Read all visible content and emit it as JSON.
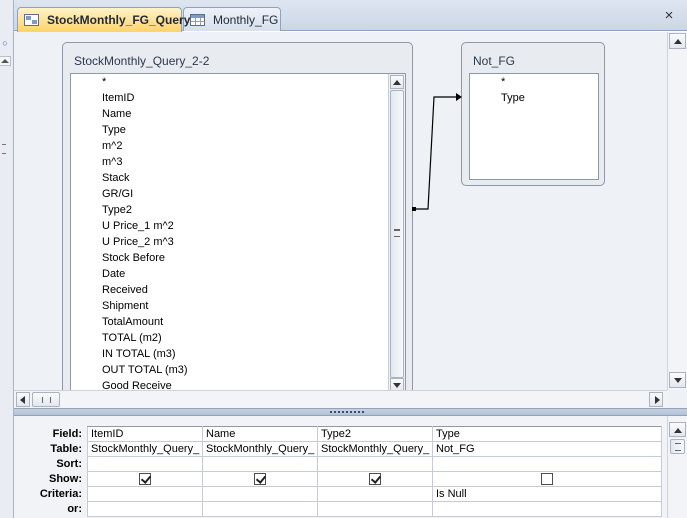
{
  "tabs": [
    {
      "label": "StockMonthly_FG_Query",
      "icon": "query-icon",
      "active": true
    },
    {
      "label": "Monthly_FG",
      "icon": "table-icon",
      "active": false
    }
  ],
  "close_glyph": "×",
  "tables": {
    "stock": {
      "title": "StockMonthly_Query_2-2",
      "fields": [
        "*",
        "ItemID",
        "Name",
        "Type",
        "m^2",
        "m^3",
        "Stack",
        "GR/GI",
        "Type2",
        "U Price_1 m^2",
        "U Price_2 m^3",
        "Stock Before",
        "Date",
        "Received",
        "Shipment",
        "TotalAmount",
        "TOTAL (m2)",
        "IN TOTAL (m3)",
        "OUT TOTAL (m3)",
        "Good Receive"
      ]
    },
    "notfg": {
      "title": "Not_FG",
      "fields": [
        "*",
        "Type"
      ]
    }
  },
  "grid": {
    "row_labels": [
      "Field:",
      "Table:",
      "Sort:",
      "Show:",
      "Criteria:",
      "or:"
    ],
    "columns": [
      {
        "field": "ItemID",
        "table": "StockMonthly_Query_",
        "sort": "",
        "show": true,
        "criteria": "",
        "or": ""
      },
      {
        "field": "Name",
        "table": "StockMonthly_Query_",
        "sort": "",
        "show": true,
        "criteria": "",
        "or": ""
      },
      {
        "field": "Type2",
        "table": "StockMonthly_Query_",
        "sort": "",
        "show": true,
        "criteria": "",
        "or": ""
      },
      {
        "field": "Type",
        "table": "Not_FG",
        "sort": "",
        "show": false,
        "criteria": "Is Null",
        "or": ""
      }
    ]
  },
  "colors": {
    "active_tab": "#ffd36a",
    "pane_bg": "#eef1f5",
    "accent": "#1f5fae"
  }
}
